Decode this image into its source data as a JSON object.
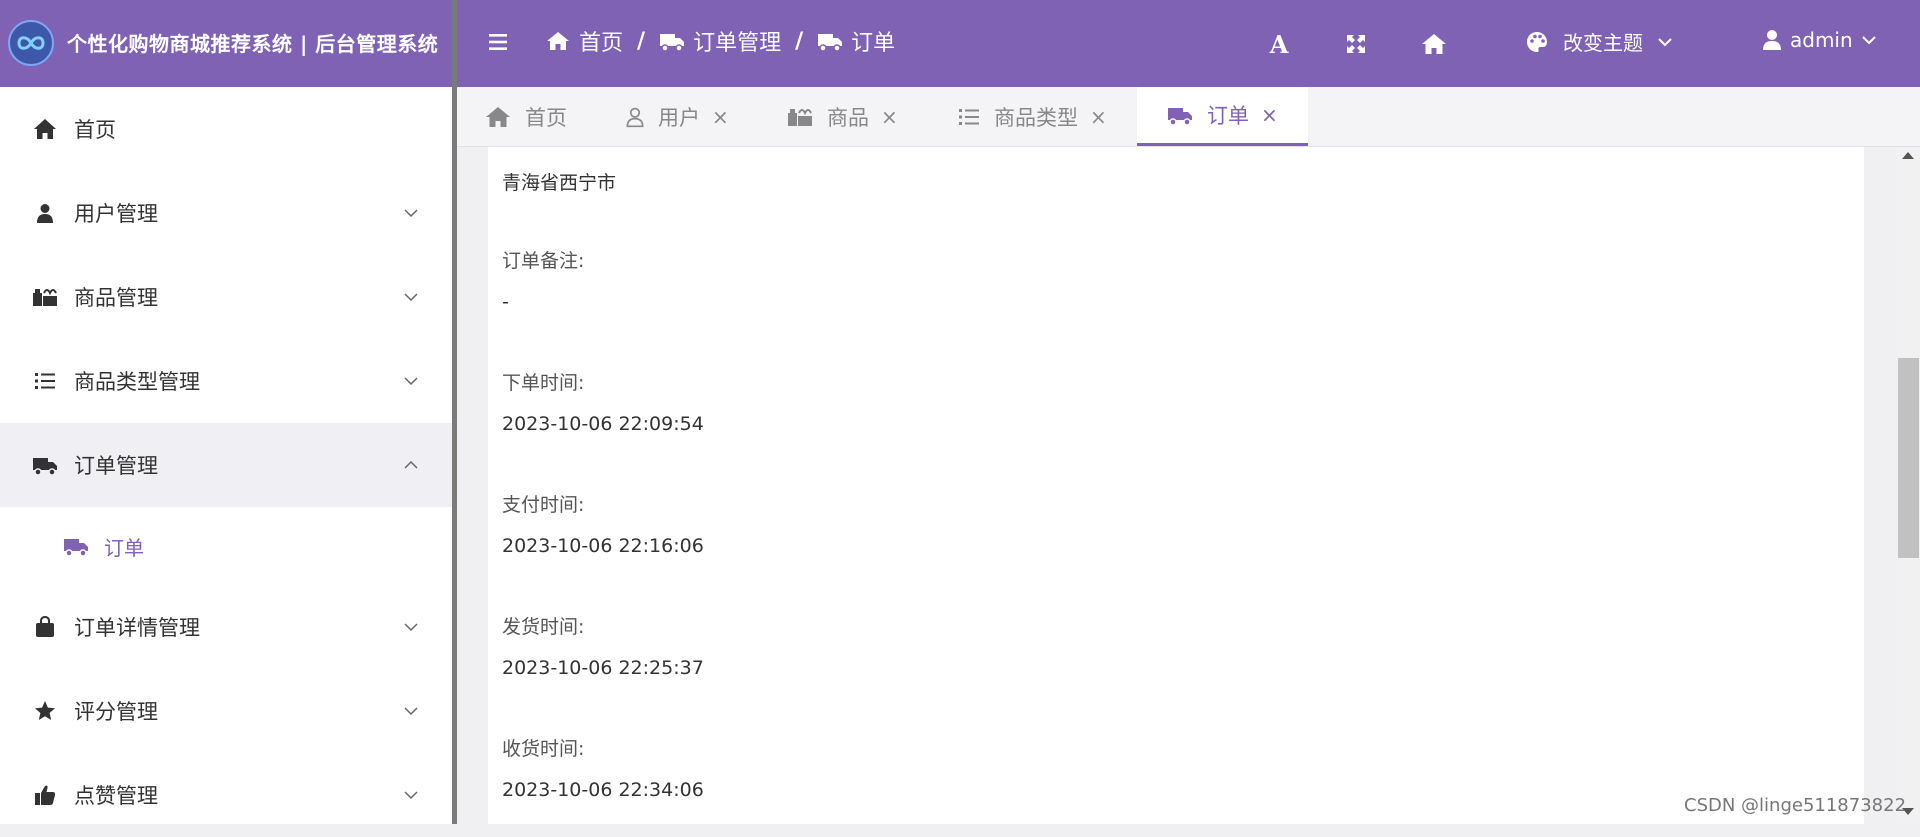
{
  "header": {
    "brand_title": "个性化购物商城推荐系统 | 后台管理系统",
    "breadcrumbs": [
      "首页",
      "订单管理",
      "订单"
    ],
    "breadcrumb_sep": "/",
    "theme_label": "改变主题",
    "user_label": "admin"
  },
  "sidebar": {
    "items": [
      {
        "label": "首页",
        "icon": "home-icon"
      },
      {
        "label": "用户管理",
        "icon": "user-icon"
      },
      {
        "label": "商品管理",
        "icon": "goods-icon"
      },
      {
        "label": "商品类型管理",
        "icon": "list-icon"
      },
      {
        "label": "订单管理",
        "icon": "truck-icon"
      },
      {
        "label": "订单",
        "icon": "truck-icon"
      },
      {
        "label": "订单详情管理",
        "icon": "bag-icon"
      },
      {
        "label": "评分管理",
        "icon": "star-icon"
      },
      {
        "label": "点赞管理",
        "icon": "thumbs-up-icon"
      }
    ]
  },
  "tabs": [
    {
      "label": "首页"
    },
    {
      "label": "用户",
      "close": "×"
    },
    {
      "label": "商品",
      "close": "×"
    },
    {
      "label": "商品类型",
      "close": "×"
    },
    {
      "label": "订单",
      "close": "×"
    }
  ],
  "detail": {
    "address_value": "青海省西宁市",
    "remark_label": "订单备注:",
    "remark_value": "-",
    "order_time_label": "下单时间:",
    "order_time_value": "2023-10-06 22:09:54",
    "pay_time_label": "支付时间:",
    "pay_time_value": "2023-10-06 22:16:06",
    "ship_time_label": "发货时间:",
    "ship_time_value": "2023-10-06 22:25:37",
    "receive_time_label": "收货时间:",
    "receive_time_value": "2023-10-06 22:34:06"
  },
  "watermark": "CSDN @linge511873822",
  "colors": {
    "accent": "#8062b4",
    "sidebar_bg": "#ffffff",
    "open_item_bg": "#f0f0f4"
  }
}
